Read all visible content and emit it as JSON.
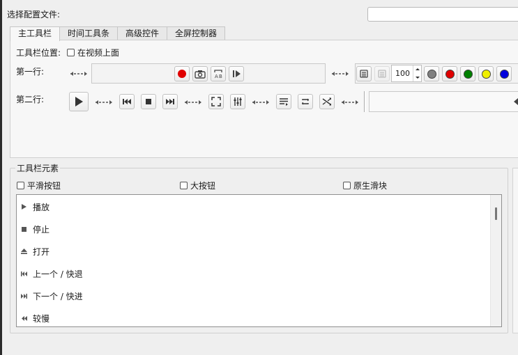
{
  "config": {
    "label": "选择配置文件:"
  },
  "tabs": [
    {
      "label": "主工具栏",
      "active": true
    },
    {
      "label": "时间工具条",
      "active": false
    },
    {
      "label": "高级控件",
      "active": false
    },
    {
      "label": "全屏控制器",
      "active": false
    }
  ],
  "main_toolbar": {
    "position_label": "工具栏位置:",
    "above_video_label": "在视频上面",
    "line1_label": "第一行:",
    "line2_label": "第二行:",
    "volume_value": "100",
    "dot_colors": [
      "#808080",
      "#e00000",
      "#008000",
      "#f0f000",
      "#0000dd"
    ],
    "record_color": "#e00000"
  },
  "elements_group": {
    "title": "工具栏元素",
    "smooth_buttons": "平滑按钮",
    "big_buttons": "大按钮",
    "native_slider": "原生滑块",
    "items": [
      {
        "icon": "play-icon",
        "label": "播放"
      },
      {
        "icon": "stop-icon",
        "label": "停止"
      },
      {
        "icon": "eject-icon",
        "label": "打开"
      },
      {
        "icon": "previous-icon",
        "label": "上一个 / 快退"
      },
      {
        "icon": "next-icon",
        "label": "下一个 / 快进"
      },
      {
        "icon": "slower-icon",
        "label": "较慢"
      }
    ]
  }
}
